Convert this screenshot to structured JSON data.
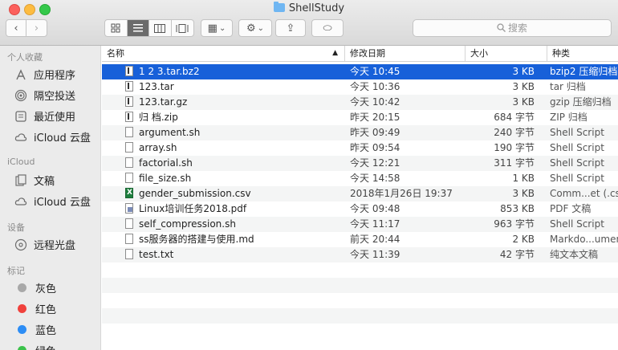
{
  "window": {
    "title": "ShellStudy"
  },
  "toolbar": {
    "back_label": "‹",
    "forward_label": "›",
    "share_label": "⇪",
    "tag_label": "⬭",
    "action_label": "⚙",
    "group_label": "▦",
    "chevron_label": "⌄"
  },
  "search": {
    "placeholder": "搜索",
    "icon": "search-icon"
  },
  "sidebar": {
    "favorites_header": "个人收藏",
    "favorites": [
      {
        "label": "应用程序",
        "icon": "applications-icon"
      },
      {
        "label": "隔空投送",
        "icon": "airdrop-icon"
      },
      {
        "label": "最近使用",
        "icon": "recents-icon"
      },
      {
        "label": "iCloud 云盘",
        "icon": "cloud-icon"
      }
    ],
    "icloud_header": "iCloud",
    "icloud": [
      {
        "label": "文稿",
        "icon": "documents-icon"
      },
      {
        "label": "iCloud 云盘",
        "icon": "cloud-icon"
      }
    ],
    "devices_header": "设备",
    "devices": [
      {
        "label": "远程光盘",
        "icon": "disc-icon"
      }
    ],
    "tags_header": "标记",
    "tags": [
      {
        "label": "灰色",
        "color": "#a8a8a8"
      },
      {
        "label": "红色",
        "color": "#f0413c"
      },
      {
        "label": "蓝色",
        "color": "#2d8df5"
      },
      {
        "label": "绿色",
        "color": "#3bc24b"
      }
    ]
  },
  "columns": {
    "name": "名称",
    "date": "修改日期",
    "size": "大小",
    "kind": "种类"
  },
  "files": [
    {
      "name": "1 2 3.tar.bz2",
      "date": "今天 10:45",
      "size": "3 KB",
      "kind": "bzip2 压缩归档",
      "icon": "document-icon",
      "selected": true
    },
    {
      "name": "123.tar",
      "date": "今天 10:36",
      "size": "3 KB",
      "kind": "tar 归档",
      "icon": "document-icon"
    },
    {
      "name": "123.tar.gz",
      "date": "今天 10:42",
      "size": "3 KB",
      "kind": "gzip 压缩归档",
      "icon": "document-icon"
    },
    {
      "name": "归 档.zip",
      "date": "昨天 20:15",
      "size": "684 字节",
      "kind": "ZIP 归档",
      "icon": "document-icon"
    },
    {
      "name": "argument.sh",
      "date": "昨天 09:49",
      "size": "240 字节",
      "kind": "Shell Script",
      "icon": "script-icon"
    },
    {
      "name": "array.sh",
      "date": "昨天 09:54",
      "size": "190 字节",
      "kind": "Shell Script",
      "icon": "script-icon"
    },
    {
      "name": "factorial.sh",
      "date": "今天 12:21",
      "size": "311 字节",
      "kind": "Shell Script",
      "icon": "script-icon"
    },
    {
      "name": "file_size.sh",
      "date": "今天 14:58",
      "size": "1 KB",
      "kind": "Shell Script",
      "icon": "script-icon"
    },
    {
      "name": "gender_submission.csv",
      "date": "2018年1月26日 19:37",
      "size": "3 KB",
      "kind": "Comm...et (.csv)",
      "icon": "spreadsheet-icon"
    },
    {
      "name": "Linux培训任务2018.pdf",
      "date": "今天 09:48",
      "size": "853 KB",
      "kind": "PDF 文稿",
      "icon": "pdf-icon"
    },
    {
      "name": "self_compression.sh",
      "date": "今天 11:17",
      "size": "963 字节",
      "kind": "Shell Script",
      "icon": "script-icon"
    },
    {
      "name": "ss服务器的搭建与使用.md",
      "date": "前天 20:44",
      "size": "2 KB",
      "kind": "Markdo...ument",
      "icon": "script-icon"
    },
    {
      "name": "test.txt",
      "date": "今天 11:39",
      "size": "42 字节",
      "kind": "纯文本文稿",
      "icon": "text-icon"
    }
  ]
}
